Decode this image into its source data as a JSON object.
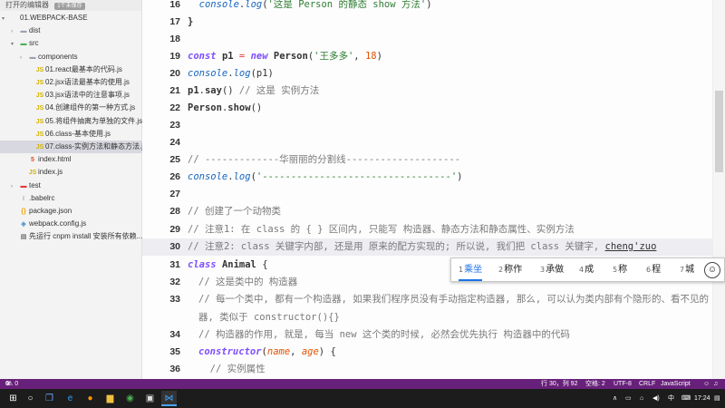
{
  "sidebar": {
    "open_editors_label": "打开的编辑器",
    "open_editors_badge": "1个未保存",
    "items": [
      {
        "label": "01.WEBPACK-BASE",
        "type": "root"
      },
      {
        "label": "dist",
        "type": "folder"
      },
      {
        "label": "src",
        "type": "folder-open"
      },
      {
        "label": "components",
        "type": "folder"
      },
      {
        "label": "01.react最基本的代码.js",
        "type": "js"
      },
      {
        "label": "02.jsx语法最基本的使用.js",
        "type": "js"
      },
      {
        "label": "03.jsx语法中的注意事项.js",
        "type": "js"
      },
      {
        "label": "04.创建组件的第一种方式.js",
        "type": "js"
      },
      {
        "label": "05.将组件抽离为单独的文件.js",
        "type": "js"
      },
      {
        "label": "06.class-基本使用.js",
        "type": "js"
      },
      {
        "label": "07.class-实例方法和静态方法.js",
        "type": "js",
        "selected": true
      },
      {
        "label": "index.html",
        "type": "html"
      },
      {
        "label": "index.js",
        "type": "js"
      },
      {
        "label": "test",
        "type": "folder"
      },
      {
        "label": ".babelrc",
        "type": "dot"
      },
      {
        "label": "package.json",
        "type": "json"
      },
      {
        "label": "webpack.config.js",
        "type": "webpack"
      },
      {
        "label": "先运行 cnpm install 安装所有依赖...",
        "type": "info"
      }
    ]
  },
  "editor": {
    "lines": [
      {
        "n": "16",
        "parts": [
          [
            "  ",
            ""
          ],
          [
            "console",
            "fn"
          ],
          [
            ".",
            ""
          ],
          [
            "log",
            "fn"
          ],
          [
            "(",
            ""
          ],
          [
            "'这是 Person 的静态 show 方法'",
            "str"
          ],
          [
            ")",
            ""
          ]
        ]
      },
      {
        "n": "17",
        "parts": [
          [
            "}",
            "bold"
          ]
        ]
      },
      {
        "n": "18",
        "parts": []
      },
      {
        "n": "19",
        "parts": [
          [
            "const",
            "kw"
          ],
          [
            " ",
            ""
          ],
          [
            "p1",
            "bold"
          ],
          [
            " ",
            ""
          ],
          [
            "=",
            "op"
          ],
          [
            " ",
            ""
          ],
          [
            "new",
            "kw"
          ],
          [
            " ",
            ""
          ],
          [
            "Person",
            "bold"
          ],
          [
            "(",
            ""
          ],
          [
            "'王多多'",
            "str"
          ],
          [
            ", ",
            ""
          ],
          [
            "18",
            "num"
          ],
          [
            ")",
            ""
          ]
        ]
      },
      {
        "n": "20",
        "parts": [
          [
            "console",
            "fn"
          ],
          [
            ".",
            ""
          ],
          [
            "log",
            "fn"
          ],
          [
            "(p1)",
            ""
          ]
        ]
      },
      {
        "n": "21",
        "parts": [
          [
            "p1",
            "bold"
          ],
          [
            ".",
            ""
          ],
          [
            "say",
            "bold"
          ],
          [
            "() ",
            ""
          ],
          [
            "// 这是 实例方法",
            "cm"
          ]
        ]
      },
      {
        "n": "22",
        "parts": [
          [
            "Person",
            "bold"
          ],
          [
            ".",
            ""
          ],
          [
            "show",
            "bold"
          ],
          [
            "()",
            ""
          ]
        ]
      },
      {
        "n": "23",
        "parts": []
      },
      {
        "n": "24",
        "parts": []
      },
      {
        "n": "25",
        "parts": [
          [
            "// -------------华丽丽的分割线--------------------",
            "cm"
          ]
        ]
      },
      {
        "n": "26",
        "parts": [
          [
            "console",
            "fn"
          ],
          [
            ".",
            ""
          ],
          [
            "log",
            "fn"
          ],
          [
            "(",
            ""
          ],
          [
            "'---------------------------------'",
            "str"
          ],
          [
            ")",
            ""
          ]
        ]
      },
      {
        "n": "27",
        "parts": []
      },
      {
        "n": "28",
        "parts": [
          [
            "// 创建了一个动物类",
            "cm"
          ]
        ]
      },
      {
        "n": "29",
        "parts": [
          [
            "// 注意1: 在 class 的 { } 区间内, 只能写 构造器、静态方法和静态属性、实例方法",
            "cm"
          ]
        ]
      },
      {
        "n": "30",
        "parts": [
          [
            "// 注意2: class 关键字内部, 还是用 原来的配方实现的; 所以说, 我们把 class 关键字, ",
            "cm"
          ],
          [
            "cheng'zuo",
            "underline"
          ]
        ],
        "cursor": true
      },
      {
        "n": "31",
        "parts": [
          [
            "class",
            "kw"
          ],
          [
            " ",
            ""
          ],
          [
            "Animal",
            "bold"
          ],
          [
            " {",
            ""
          ]
        ]
      },
      {
        "n": "32",
        "sub": true,
        "parts": [
          [
            "// 这是类中的 构造器",
            "cm"
          ]
        ]
      },
      {
        "n": "33",
        "sub": true,
        "parts": [
          [
            "// 每一个类中, 都有一个构造器, 如果我们程序员没有手动指定构造器, 那么, 可以认为类内部有个隐形的、看不见的 空构造",
            "cm"
          ]
        ]
      },
      {
        "n": "",
        "sub": true,
        "parts": [
          [
            "器, 类似于 constructor(){}",
            "cm"
          ]
        ]
      },
      {
        "n": "34",
        "sub": true,
        "parts": [
          [
            "// 构造器的作用, 就是, 每当 new 这个类的时候, 必然会优先执行 构造器中的代码",
            "cm"
          ]
        ]
      },
      {
        "n": "35",
        "sub": true,
        "parts": [
          [
            "constructor",
            "kw"
          ],
          [
            "(",
            ""
          ],
          [
            "name",
            "prm"
          ],
          [
            ", ",
            ""
          ],
          [
            "age",
            "prm"
          ],
          [
            ") {",
            ""
          ]
        ]
      },
      {
        "n": "36",
        "sub": true,
        "parts": [
          [
            "  // 实例属性",
            "cm"
          ]
        ]
      }
    ]
  },
  "ime": {
    "candidates": [
      {
        "idx": "1",
        "text": "乘坐"
      },
      {
        "idx": "2",
        "text": "称作"
      },
      {
        "idx": "3",
        "text": "承做"
      },
      {
        "idx": "4",
        "text": "成"
      },
      {
        "idx": "5",
        "text": "称"
      },
      {
        "idx": "6",
        "text": "程"
      },
      {
        "idx": "7",
        "text": "城"
      }
    ],
    "emoji_icon": "smiley-icon"
  },
  "statusbar": {
    "errors": "0",
    "warnings": "0",
    "position": "行 30，列 92",
    "spaces": "空格: 2",
    "encoding": "UTF-8",
    "eol": "CRLF",
    "language": "JavaScript",
    "accent": "#68217a"
  },
  "taskbar": {
    "ime_lang": "中",
    "time": "17:24"
  }
}
